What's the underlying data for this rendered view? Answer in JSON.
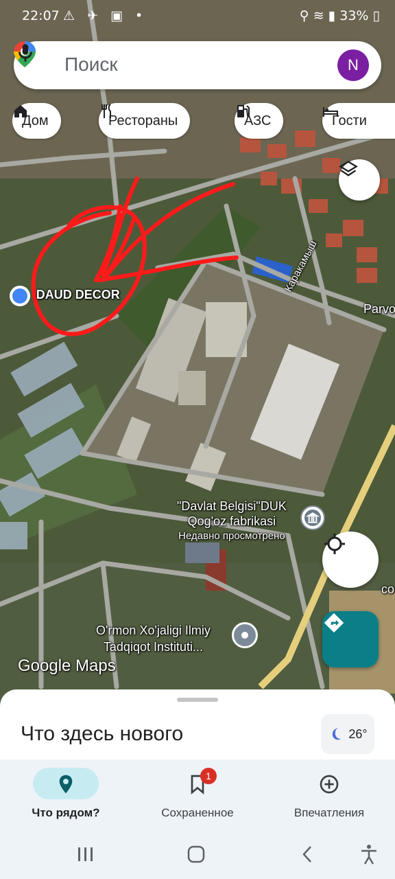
{
  "status_bar": {
    "time": "22:07",
    "left_icons": "⚠ ✈ ▣ •",
    "battery": "33%"
  },
  "search": {
    "placeholder": "Поиск",
    "avatar_letter": "N"
  },
  "chips": [
    {
      "label": "Дом",
      "icon": "home-icon"
    },
    {
      "label": "Рестораны",
      "icon": "restaurant-icon"
    },
    {
      "label": "АЗС",
      "icon": "gas-station-icon"
    },
    {
      "label": "Гости",
      "icon": "hotel-icon"
    }
  ],
  "map": {
    "place_daud": "DAUD DECOR",
    "street_karakamysh": "Каракамыш",
    "place_parvo": "Parvo",
    "davlat_line1": "\"Davlat Belgisi\"DUK",
    "davlat_line2": "Qog'oz fabrikasi",
    "davlat_line3": "Недавно просмотрено",
    "ormon_line1": "O'rmon Xo'jaligi Ilmiy",
    "ormon_line2": "Tadqiqot Instituti...",
    "edge_label": "co",
    "google_logo": "Google Maps"
  },
  "sheet": {
    "title": "Что здесь нового",
    "weather_temp": "26°"
  },
  "nav": [
    {
      "label": "Что рядом?",
      "icon": "location-pin-icon",
      "active": true
    },
    {
      "label": "Сохраненное",
      "icon": "bookmark-icon",
      "badge": "1"
    },
    {
      "label": "Впечатления",
      "icon": "add-circle-icon"
    }
  ],
  "colors": {
    "accent": "#0b7f87",
    "avatar": "#7b1fa2",
    "annotation": "#ff1a1a",
    "badge": "#d93025"
  }
}
